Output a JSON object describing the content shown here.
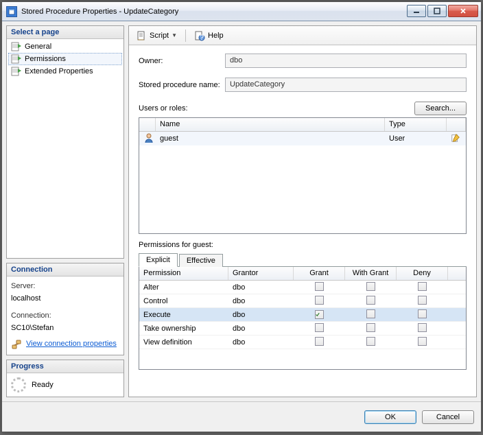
{
  "window": {
    "title": "Stored Procedure Properties - UpdateCategory"
  },
  "sidebar": {
    "select_page_header": "Select a page",
    "pages": [
      {
        "label": "General"
      },
      {
        "label": "Permissions"
      },
      {
        "label": "Extended Properties"
      }
    ],
    "connection_header": "Connection",
    "server_label": "Server:",
    "server_value": "localhost",
    "connection_label": "Connection:",
    "connection_value": "SC10\\Stefan",
    "view_conn_link": "View connection properties",
    "progress_header": "Progress",
    "progress_status": "Ready"
  },
  "toolbar": {
    "script": "Script",
    "help": "Help"
  },
  "form": {
    "owner_label": "Owner:",
    "owner_value": "dbo",
    "spname_label": "Stored procedure name:",
    "spname_value": "UpdateCategory",
    "users_label": "Users or roles:",
    "search_btn": "Search..."
  },
  "users_grid": {
    "columns": {
      "name": "Name",
      "type": "Type"
    },
    "rows": [
      {
        "name": "guest",
        "type": "User"
      }
    ]
  },
  "perms": {
    "label": "Permissions for guest:",
    "tabs": {
      "explicit": "Explicit",
      "effective": "Effective"
    },
    "columns": {
      "permission": "Permission",
      "grantor": "Grantor",
      "grant": "Grant",
      "with_grant": "With Grant",
      "deny": "Deny"
    },
    "rows": [
      {
        "permission": "Alter",
        "grantor": "dbo",
        "grant": false,
        "with_grant": false,
        "deny": false,
        "selected": false
      },
      {
        "permission": "Control",
        "grantor": "dbo",
        "grant": false,
        "with_grant": false,
        "deny": false,
        "selected": false
      },
      {
        "permission": "Execute",
        "grantor": "dbo",
        "grant": true,
        "with_grant": false,
        "deny": false,
        "selected": true
      },
      {
        "permission": "Take ownership",
        "grantor": "dbo",
        "grant": false,
        "with_grant": false,
        "deny": false,
        "selected": false
      },
      {
        "permission": "View definition",
        "grantor": "dbo",
        "grant": false,
        "with_grant": false,
        "deny": false,
        "selected": false
      }
    ]
  },
  "footer": {
    "ok": "OK",
    "cancel": "Cancel"
  }
}
